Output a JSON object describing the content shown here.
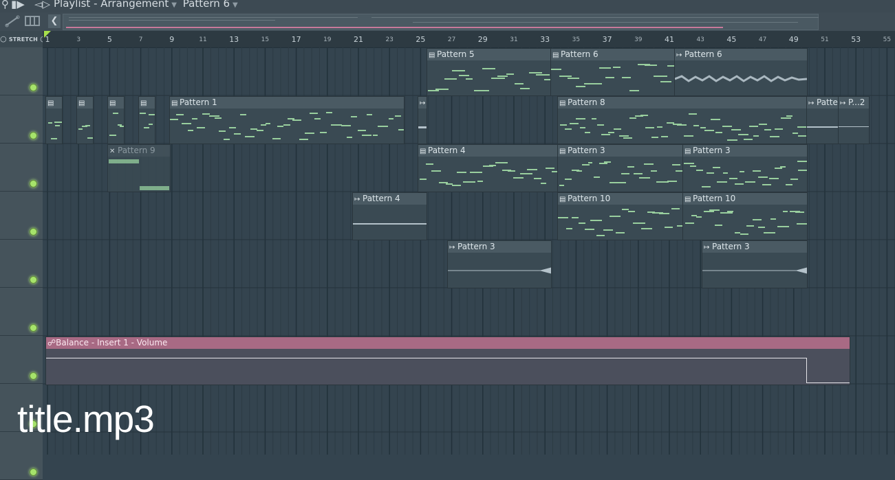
{
  "titlebar": {
    "label_playlist": "Playlist - Arrangement",
    "label_pattern": "Pattern 6"
  },
  "ruler": {
    "stretch_label": "STRETCH",
    "major": [
      "1",
      "5",
      "9",
      "13",
      "17",
      "21",
      "25",
      "29",
      "33",
      "37",
      "41",
      "45",
      "49",
      "53"
    ],
    "minor": [
      "3",
      "7",
      "11",
      "15",
      "19",
      "23",
      "27",
      "31",
      "35",
      "39",
      "43",
      "47",
      "51",
      "55"
    ]
  },
  "clips": {
    "t1_pattern5": "Pattern 5",
    "t1_pattern6a": "Pattern 6",
    "t1_pattern6b": "Pattern 6",
    "t2_pattern1": "Pattern 1",
    "t2_pattern8": "Pattern 8",
    "t2_patte": "Patte",
    "t2_p2": "P...2",
    "t3_pattern9": "Pattern 9",
    "t3_pattern4": "Pattern 4",
    "t3_pattern3a": "Pattern 3",
    "t3_pattern3b": "Pattern 3",
    "t4_pattern4": "Pattern 4",
    "t4_pattern10a": "Pattern 10",
    "t4_pattern10b": "Pattern 10",
    "t5_pattern3a": "Pattern 3",
    "t5_pattern3b": "Pattern 3"
  },
  "automation": {
    "label": "Balance - Insert 1 - Volume"
  },
  "overlay": {
    "text": "title.mp3"
  },
  "colors": {
    "note_green": "#99cf9e",
    "automation_pink": "#a86a84",
    "led_green": "#a6e36b"
  }
}
